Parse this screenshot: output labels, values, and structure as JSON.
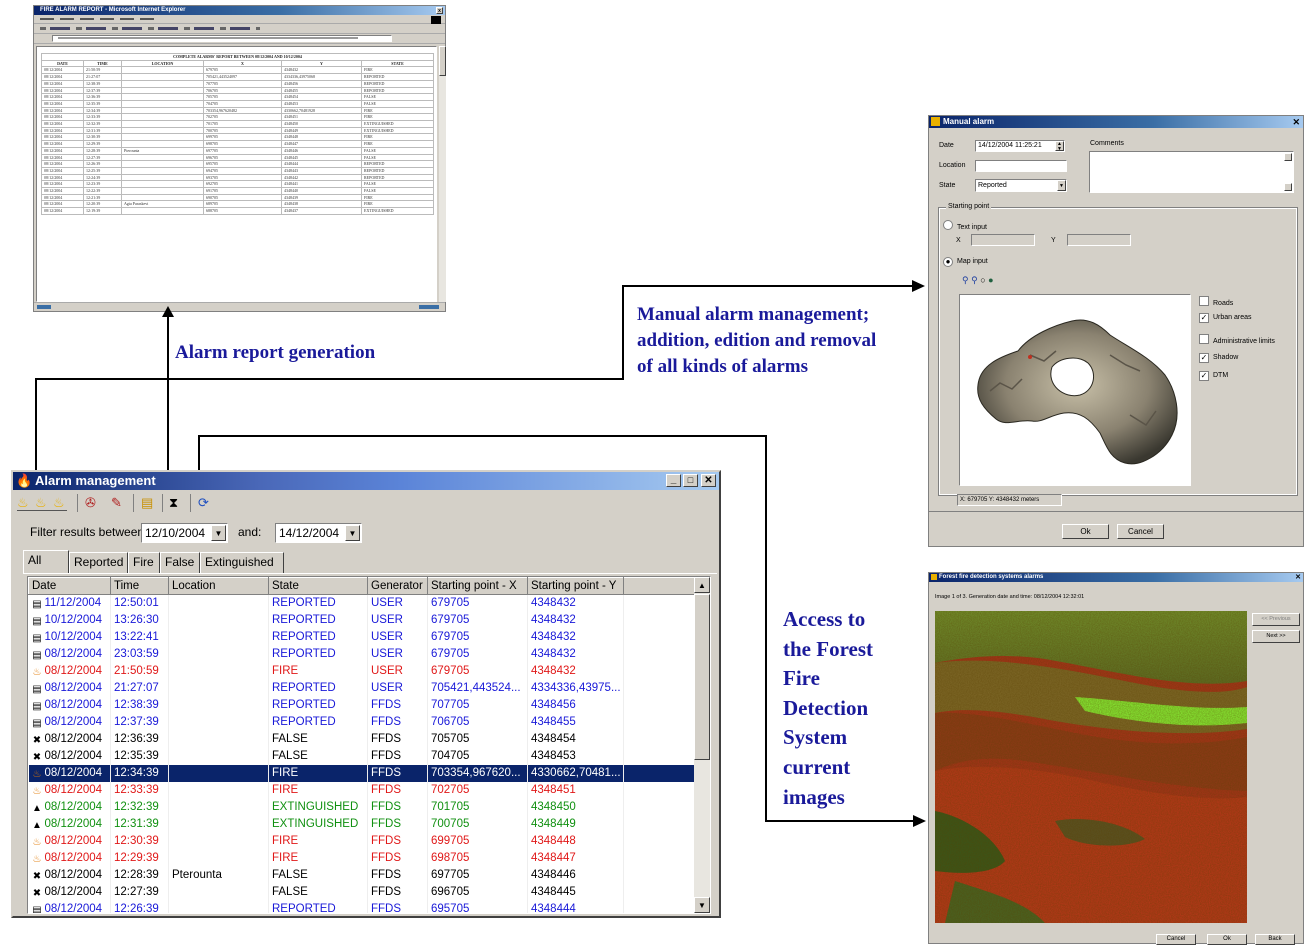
{
  "captions": {
    "report": "Alarm report generation",
    "manual_1": "Manual alarm management;",
    "manual_2": "addition, edition and removal",
    "manual_3": "of all kinds of alarms",
    "access": [
      "Access to",
      "the Forest",
      "Fire",
      "Detection",
      "System",
      "current",
      "images"
    ]
  },
  "report_window": {
    "title": "FIRE ALARM REPORT - Microsoft Internet Explorer",
    "heading": "COMPLETE ALARMS' REPORT BETWEEN 08/12/2004 AND 10/12/2004",
    "columns": [
      "DATE",
      "TIME",
      "LOCATION",
      "X",
      "Y",
      "STATE"
    ],
    "rows": [
      [
        "08/12/2004",
        "21:50:59",
        "",
        "679705",
        "4348432",
        "FIRE"
      ],
      [
        "08/12/2004",
        "21:27:07",
        "",
        "705421,443524097",
        "4334336,43975068",
        "REPORTED"
      ],
      [
        "08/12/2004",
        "12:38:39",
        "",
        "707705",
        "4348456",
        "REPORTED"
      ],
      [
        "08/12/2004",
        "12:37:39",
        "",
        "706705",
        "4348455",
        "REPORTED"
      ],
      [
        "08/12/2004",
        "12:36:39",
        "",
        "705705",
        "4348454",
        "FALSE"
      ],
      [
        "08/12/2004",
        "12:35:39",
        "",
        "704705",
        "4348453",
        "FALSE"
      ],
      [
        "08/12/2004",
        "12:34:39",
        "",
        "703354,967620482",
        "4330662,70481928",
        "FIRE"
      ],
      [
        "08/12/2004",
        "12:33:39",
        "",
        "702705",
        "4348451",
        "FIRE"
      ],
      [
        "08/12/2004",
        "12:32:39",
        "",
        "701705",
        "4348450",
        "EXTINGUISHED"
      ],
      [
        "08/12/2004",
        "12:31:39",
        "",
        "700705",
        "4348449",
        "EXTINGUISHED"
      ],
      [
        "08/12/2004",
        "12:30:39",
        "",
        "699705",
        "4348448",
        "FIRE"
      ],
      [
        "08/12/2004",
        "12:29:39",
        "",
        "698705",
        "4348447",
        "FIRE"
      ],
      [
        "08/12/2004",
        "12:28:39",
        "Pterounta",
        "697705",
        "4348446",
        "FALSE"
      ],
      [
        "08/12/2004",
        "12:27:39",
        "",
        "696705",
        "4348445",
        "FALSE"
      ],
      [
        "08/12/2004",
        "12:26:39",
        "",
        "695705",
        "4348444",
        "REPORTED"
      ],
      [
        "08/12/2004",
        "12:25:39",
        "",
        "694705",
        "4348443",
        "REPORTED"
      ],
      [
        "08/12/2004",
        "12:24:39",
        "",
        "693705",
        "4348442",
        "REPORTED"
      ],
      [
        "08/12/2004",
        "12:23:39",
        "",
        "692705",
        "4348441",
        "FALSE"
      ],
      [
        "08/12/2004",
        "12:22:39",
        "",
        "691705",
        "4348440",
        "FALSE"
      ],
      [
        "08/12/2004",
        "12:21:39",
        "",
        "690705",
        "4348439",
        "FIRE"
      ],
      [
        "08/12/2004",
        "12:20:39",
        "Agia Paraskevi",
        "689705",
        "4348438",
        "FIRE"
      ],
      [
        "08/12/2004",
        "12:19:39",
        "",
        "688705",
        "4348437",
        "EXTINGUISHED"
      ]
    ]
  },
  "alarm_window": {
    "title": "Alarm management",
    "filter_label": "Filter results between:",
    "date_from": "12/10/2004",
    "and_label": "and:",
    "date_to": "14/12/2004",
    "tabs": [
      "All",
      "Reported",
      "Fire",
      "False",
      "Extinguished"
    ],
    "columns": [
      "Date",
      "Time",
      "Location",
      "State",
      "Generator",
      "Starting point - X",
      "Starting point - Y"
    ],
    "rows": [
      {
        "date": "11/12/2004",
        "time": "12:50:01",
        "loc": "",
        "state": "REPORTED",
        "gen": "USER",
        "x": "679705",
        "y": "4348432",
        "kind": "rep"
      },
      {
        "date": "10/12/2004",
        "time": "13:26:30",
        "loc": "",
        "state": "REPORTED",
        "gen": "USER",
        "x": "679705",
        "y": "4348432",
        "kind": "rep"
      },
      {
        "date": "10/12/2004",
        "time": "13:22:41",
        "loc": "",
        "state": "REPORTED",
        "gen": "USER",
        "x": "679705",
        "y": "4348432",
        "kind": "rep"
      },
      {
        "date": "08/12/2004",
        "time": "23:03:59",
        "loc": "",
        "state": "REPORTED",
        "gen": "USER",
        "x": "679705",
        "y": "4348432",
        "kind": "rep"
      },
      {
        "date": "08/12/2004",
        "time": "21:50:59",
        "loc": "",
        "state": "FIRE",
        "gen": "USER",
        "x": "679705",
        "y": "4348432",
        "kind": "fire"
      },
      {
        "date": "08/12/2004",
        "time": "21:27:07",
        "loc": "",
        "state": "REPORTED",
        "gen": "USER",
        "x": "705421,443524...",
        "y": "4334336,43975...",
        "kind": "rep"
      },
      {
        "date": "08/12/2004",
        "time": "12:38:39",
        "loc": "",
        "state": "REPORTED",
        "gen": "FFDS",
        "x": "707705",
        "y": "4348456",
        "kind": "rep"
      },
      {
        "date": "08/12/2004",
        "time": "12:37:39",
        "loc": "",
        "state": "REPORTED",
        "gen": "FFDS",
        "x": "706705",
        "y": "4348455",
        "kind": "rep"
      },
      {
        "date": "08/12/2004",
        "time": "12:36:39",
        "loc": "",
        "state": "FALSE",
        "gen": "FFDS",
        "x": "705705",
        "y": "4348454",
        "kind": "false"
      },
      {
        "date": "08/12/2004",
        "time": "12:35:39",
        "loc": "",
        "state": "FALSE",
        "gen": "FFDS",
        "x": "704705",
        "y": "4348453",
        "kind": "false"
      },
      {
        "date": "08/12/2004",
        "time": "12:34:39",
        "loc": "",
        "state": "FIRE",
        "gen": "FFDS",
        "x": "703354,967620...",
        "y": "4330662,70481...",
        "kind": "fire",
        "selected": true
      },
      {
        "date": "08/12/2004",
        "time": "12:33:39",
        "loc": "",
        "state": "FIRE",
        "gen": "FFDS",
        "x": "702705",
        "y": "4348451",
        "kind": "fire"
      },
      {
        "date": "08/12/2004",
        "time": "12:32:39",
        "loc": "",
        "state": "EXTINGUISHED",
        "gen": "FFDS",
        "x": "701705",
        "y": "4348450",
        "kind": "ext"
      },
      {
        "date": "08/12/2004",
        "time": "12:31:39",
        "loc": "",
        "state": "EXTINGUISHED",
        "gen": "FFDS",
        "x": "700705",
        "y": "4348449",
        "kind": "ext"
      },
      {
        "date": "08/12/2004",
        "time": "12:30:39",
        "loc": "",
        "state": "FIRE",
        "gen": "FFDS",
        "x": "699705",
        "y": "4348448",
        "kind": "fire"
      },
      {
        "date": "08/12/2004",
        "time": "12:29:39",
        "loc": "",
        "state": "FIRE",
        "gen": "FFDS",
        "x": "698705",
        "y": "4348447",
        "kind": "fire"
      },
      {
        "date": "08/12/2004",
        "time": "12:28:39",
        "loc": "Pterounta",
        "state": "FALSE",
        "gen": "FFDS",
        "x": "697705",
        "y": "4348446",
        "kind": "false"
      },
      {
        "date": "08/12/2004",
        "time": "12:27:39",
        "loc": "",
        "state": "FALSE",
        "gen": "FFDS",
        "x": "696705",
        "y": "4348445",
        "kind": "false"
      },
      {
        "date": "08/12/2004",
        "time": "12:26:39",
        "loc": "",
        "state": "REPORTED",
        "gen": "FFDS",
        "x": "695705",
        "y": "4348444",
        "kind": "rep"
      }
    ],
    "colors": {
      "reported": "#1818d8",
      "fire": "#e01818",
      "extinguished": "#109010",
      "false": "#000000",
      "selected": "#0a246a"
    }
  },
  "manual_window": {
    "title": "Manual alarm",
    "date_label": "Date",
    "date_value": "14/12/2004 11:25:21",
    "location_label": "Location",
    "state_label": "State",
    "state_value": "Reported",
    "comments_label": "Comments",
    "starting_point": "Starting point",
    "text_input": "Text input",
    "x_label": "X",
    "y_label": "Y",
    "map_input": "Map input",
    "layers": [
      "Roads",
      "Urban areas",
      "Administrative limits",
      "Shadow",
      "DTM"
    ],
    "layers_checked": [
      false,
      true,
      false,
      true,
      true
    ],
    "coords": "X: 679705 Y: 4348432 meters",
    "ok": "Ok",
    "cancel": "Cancel"
  },
  "ffds_window": {
    "title": "Forest fire detection systems alarms",
    "info": "Image 1 of 3. Generation date and time: 08/12/2004 12:32:01",
    "previous": "<< Previous",
    "next": "Next >>",
    "cancel": "Cancel",
    "ok": "Ok",
    "back": "Back"
  }
}
